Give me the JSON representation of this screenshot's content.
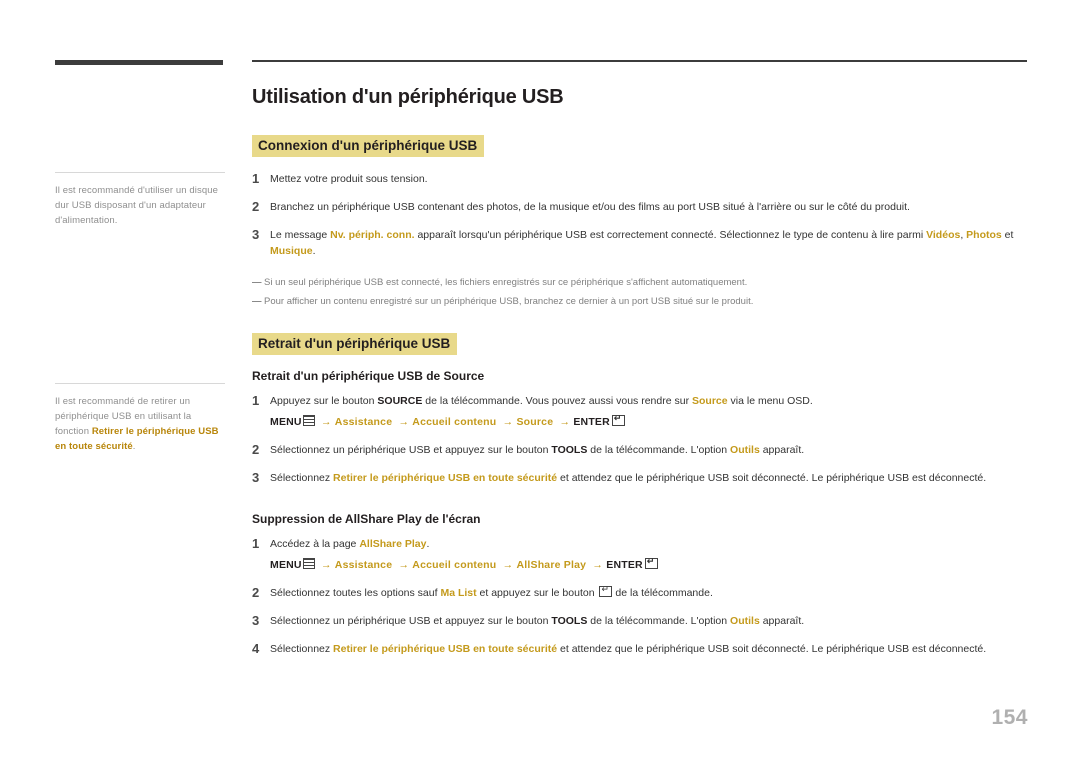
{
  "page": {
    "number": "154"
  },
  "notes": [
    {
      "id": "note-usb-disk",
      "text": "Il est recommandé d'utiliser un disque dur USB disposant d'un adaptateur d'alimentation."
    },
    {
      "id": "note-remove-usb",
      "text_before": "Il est recommandé de retirer un périphérique USB en utilisant la fonction ",
      "highlight": "Retirer le périphérique USB en toute sécurité",
      "text_after": "."
    }
  ],
  "title": "Utilisation d'un périphérique USB",
  "sections": [
    {
      "heading": "Connexion d'un périphérique USB",
      "steps": [
        {
          "num": "1",
          "parts": [
            {
              "t": "text",
              "v": "Mettez votre produit sous tension."
            }
          ]
        },
        {
          "num": "2",
          "parts": [
            {
              "t": "text",
              "v": "Branchez un périphérique USB contenant des photos, de la musique et/ou des films au port USB situé à l'arrière ou sur le côté du produit."
            }
          ]
        },
        {
          "num": "3",
          "parts": [
            {
              "t": "text",
              "v": "Le message "
            },
            {
              "t": "gold",
              "v": "Nv. périph. conn."
            },
            {
              "t": "text",
              "v": " apparaît lorsqu'un périphérique USB est correctement connecté. Sélectionnez le type de contenu à lire parmi "
            },
            {
              "t": "gold",
              "v": "Vidéos"
            },
            {
              "t": "text",
              "v": ", "
            },
            {
              "t": "gold",
              "v": "Photos"
            },
            {
              "t": "text",
              "v": " et "
            },
            {
              "t": "gold",
              "v": "Musique"
            },
            {
              "t": "text",
              "v": "."
            }
          ]
        }
      ],
      "bullets": [
        "Si un seul périphérique USB est connecté, les fichiers enregistrés sur ce périphérique s'affichent automatiquement.",
        "Pour afficher un contenu enregistré sur un périphérique USB, branchez ce dernier à un port USB situé sur le produit."
      ]
    },
    {
      "heading": "Retrait d'un périphérique USB",
      "subsections": [
        {
          "sub_heading": "Retrait d'un périphérique USB de Source",
          "steps": [
            {
              "num": "1",
              "parts": [
                {
                  "t": "text",
                  "v": "Appuyez sur le bouton "
                },
                {
                  "t": "b",
                  "v": "SOURCE"
                },
                {
                  "t": "text",
                  "v": " de la télécommande. Vous pouvez aussi vous rendre sur "
                },
                {
                  "t": "gold",
                  "v": "Source"
                },
                {
                  "t": "text",
                  "v": " via le menu OSD."
                }
              ],
              "menu_path": {
                "prefix": "MENU",
                "icon": "menu-icon",
                "items": [
                  "Assistance",
                  "Accueil contenu",
                  "Source"
                ],
                "enter_label": "ENTER",
                "enter_icon": "enter-key-icon"
              }
            },
            {
              "num": "2",
              "parts": [
                {
                  "t": "text",
                  "v": "Sélectionnez un périphérique USB et appuyez sur le bouton "
                },
                {
                  "t": "b",
                  "v": "TOOLS"
                },
                {
                  "t": "text",
                  "v": " de la télécommande. L'option "
                },
                {
                  "t": "gold",
                  "v": "Outils"
                },
                {
                  "t": "text",
                  "v": " apparaît."
                }
              ]
            },
            {
              "num": "3",
              "parts": [
                {
                  "t": "text",
                  "v": "Sélectionnez "
                },
                {
                  "t": "gold",
                  "v": "Retirer le périphérique USB en toute sécurité"
                },
                {
                  "t": "text",
                  "v": " et attendez que le périphérique USB soit déconnecté. Le périphérique USB est déconnecté."
                }
              ]
            }
          ]
        },
        {
          "sub_heading": "Suppression de AllShare Play de l'écran",
          "steps": [
            {
              "num": "1",
              "parts": [
                {
                  "t": "text",
                  "v": "Accédez à la page "
                },
                {
                  "t": "gold",
                  "v": "AllShare Play"
                },
                {
                  "t": "text",
                  "v": "."
                }
              ],
              "menu_path": {
                "prefix": "MENU",
                "icon": "menu-icon",
                "items": [
                  "Assistance",
                  "Accueil contenu",
                  "AllShare Play"
                ],
                "enter_label": "ENTER",
                "enter_icon": "enter-key-icon"
              }
            },
            {
              "num": "2",
              "parts": [
                {
                  "t": "text",
                  "v": "Sélectionnez toutes les options sauf "
                },
                {
                  "t": "gold",
                  "v": "Ma List"
                },
                {
                  "t": "text",
                  "v": " et appuyez sur le bouton "
                },
                {
                  "t": "enter-icon",
                  "v": ""
                },
                {
                  "t": "text",
                  "v": " de la télécommande."
                }
              ]
            },
            {
              "num": "3",
              "parts": [
                {
                  "t": "text",
                  "v": "Sélectionnez un périphérique USB et appuyez sur le bouton "
                },
                {
                  "t": "b",
                  "v": "TOOLS"
                },
                {
                  "t": "text",
                  "v": " de la télécommande. L'option "
                },
                {
                  "t": "gold",
                  "v": "Outils"
                },
                {
                  "t": "text",
                  "v": " apparaît."
                }
              ]
            },
            {
              "num": "4",
              "parts": [
                {
                  "t": "text",
                  "v": "Sélectionnez "
                },
                {
                  "t": "gold",
                  "v": "Retirer le périphérique USB en toute sécurité"
                },
                {
                  "t": "text",
                  "v": " et attendez que le périphérique USB soit déconnecté. Le périphérique USB est déconnecté."
                }
              ]
            }
          ]
        }
      ]
    }
  ],
  "colors": {
    "highlight_bg": "#e8d98a",
    "gold_text": "#c49a1c",
    "body_text": "#333333",
    "note_text": "#8f8f8f",
    "page_number": "#b0b0b0"
  }
}
